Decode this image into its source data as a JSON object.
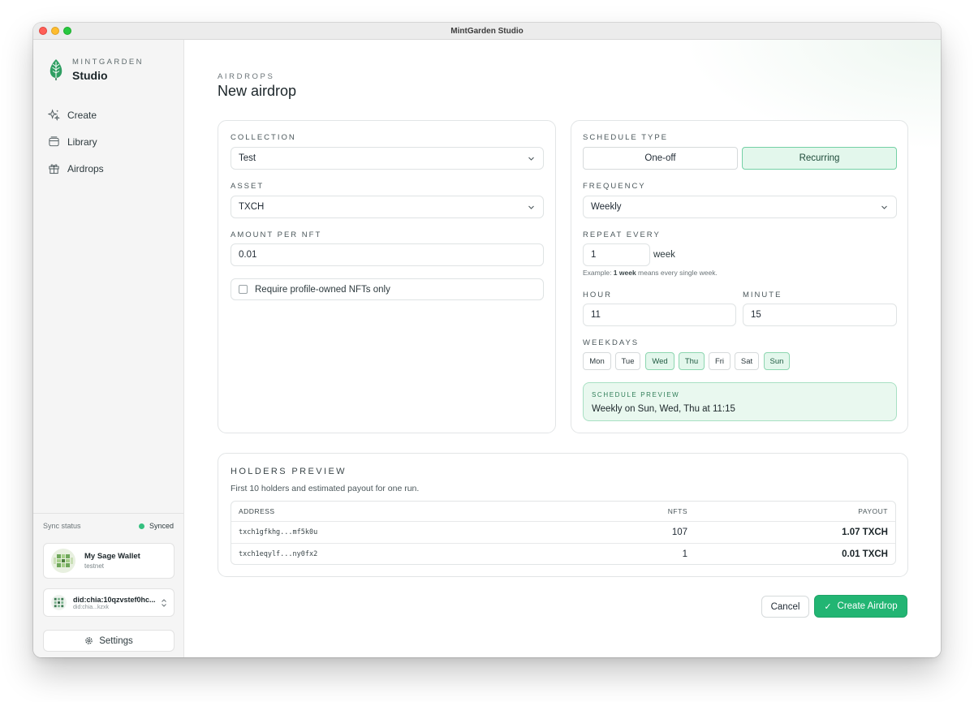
{
  "window": {
    "title": "MintGarden Studio"
  },
  "brand": {
    "kicker": "MINTGARDEN",
    "name": "Studio"
  },
  "nav": [
    {
      "label": "Create",
      "icon": "sparkles-icon"
    },
    {
      "label": "Library",
      "icon": "archive-icon"
    },
    {
      "label": "Airdrops",
      "icon": "gift-icon"
    }
  ],
  "sync": {
    "label": "Sync status",
    "status": "Synced",
    "status_color": "#35c07f"
  },
  "wallet": {
    "name": "My Sage Wallet",
    "network": "testnet"
  },
  "did": {
    "name": "did:chia:10qzvstef0hc...",
    "short": "did:chia...kzxk"
  },
  "settings": {
    "label": "Settings"
  },
  "page": {
    "breadcrumb": "AIRDROPS",
    "title": "New airdrop"
  },
  "form": {
    "collection_label": "COLLECTION",
    "collection_value": "Test",
    "asset_label": "ASSET",
    "asset_value": "TXCH",
    "amount_label": "AMOUNT PER NFT",
    "amount_value": "0.01",
    "profile_only_label": "Require profile-owned NFTs only",
    "profile_only_checked": false
  },
  "schedule": {
    "type_label": "SCHEDULE TYPE",
    "one_off_label": "One-off",
    "recurring_label": "Recurring",
    "selected": "Recurring",
    "frequency_label": "FREQUENCY",
    "frequency_value": "Weekly",
    "repeat_label": "REPEAT EVERY",
    "repeat_value": "1",
    "repeat_unit": "week",
    "hint_prefix": "Example: ",
    "hint_bold": "1 week",
    "hint_suffix": " means every single week.",
    "hour_label": "HOUR",
    "hour_value": "11",
    "minute_label": "MINUTE",
    "minute_value": "15",
    "weekdays_label": "WEEKDAYS",
    "weekdays": [
      {
        "label": "Mon",
        "selected": false
      },
      {
        "label": "Tue",
        "selected": false
      },
      {
        "label": "Wed",
        "selected": true
      },
      {
        "label": "Thu",
        "selected": true
      },
      {
        "label": "Fri",
        "selected": false
      },
      {
        "label": "Sat",
        "selected": false
      },
      {
        "label": "Sun",
        "selected": true
      }
    ],
    "preview_label": "SCHEDULE PREVIEW",
    "preview_text": "Weekly on Sun, Wed, Thu at 11:15"
  },
  "holders": {
    "title": "HOLDERS PREVIEW",
    "subtitle": "First 10 holders and estimated payout for one run.",
    "columns": [
      "ADDRESS",
      "NFTS",
      "PAYOUT"
    ],
    "rows": [
      {
        "address": "txch1gfkhg...mf5k0u",
        "nfts": "107",
        "payout": "1.07 TXCH"
      },
      {
        "address": "txch1eqylf...ny0fx2",
        "nfts": "1",
        "payout": "0.01 TXCH"
      }
    ]
  },
  "actions": {
    "cancel": "Cancel",
    "create": "Create Airdrop",
    "accent": "#22b573"
  }
}
